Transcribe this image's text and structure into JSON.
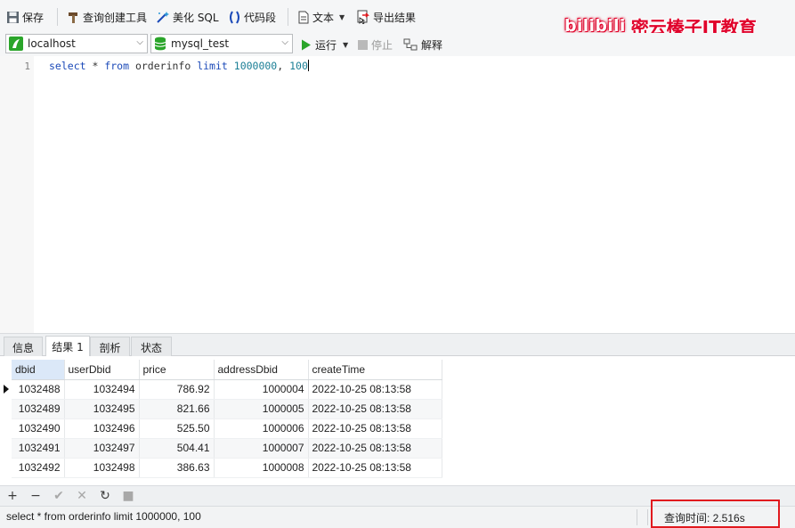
{
  "toolbar": {
    "save": "保存",
    "query_builder": "查询创建工具",
    "beautify": "美化 SQL",
    "snippet": "代码段",
    "text": "文本",
    "export": "导出结果"
  },
  "watermark": {
    "part1": "bilibili",
    "part2": "密云榛子IT教育"
  },
  "connection": {
    "value": "localhost"
  },
  "database": {
    "value": "mysql_test"
  },
  "run": {
    "run_label": "运行",
    "stop_label": "停止",
    "explain_label": "解释"
  },
  "editor": {
    "line_number": "1",
    "tokens": {
      "t1": "select",
      "t2": " * ",
      "t3": "from",
      "t4": " orderinfo ",
      "t5": "limit",
      "t6": " ",
      "t7": "1000000",
      "t8": ", ",
      "t9": "100"
    }
  },
  "tabs": [
    {
      "label": "信息"
    },
    {
      "label": "结果 1"
    },
    {
      "label": "剖析"
    },
    {
      "label": "状态"
    }
  ],
  "grid": {
    "columns": [
      "dbid",
      "userDbid",
      "price",
      "addressDbid",
      "createTime"
    ],
    "rows": [
      [
        "1032488",
        "1032494",
        "786.92",
        "1000004",
        "2022-10-25 08:13:58"
      ],
      [
        "1032489",
        "1032495",
        "821.66",
        "1000005",
        "2022-10-25 08:13:58"
      ],
      [
        "1032490",
        "1032496",
        "525.50",
        "1000006",
        "2022-10-25 08:13:58"
      ],
      [
        "1032491",
        "1032497",
        "504.41",
        "1000007",
        "2022-10-25 08:13:58"
      ],
      [
        "1032492",
        "1032498",
        "386.63",
        "1000008",
        "2022-10-25 08:13:58"
      ]
    ]
  },
  "bottom_buttons": {
    "add": "+",
    "remove": "−",
    "apply": "✔",
    "discard": "✕",
    "refresh": "↻",
    "stop": "■"
  },
  "status": {
    "sql": "select * from orderinfo limit 1000000, 100",
    "query_time": "查询时间: 2.516s"
  },
  "colors": {
    "accent_red": "#e1191e",
    "keyword_blue": "#1c4ab8",
    "number_teal": "#1a7e95",
    "run_green": "#2aa52a"
  }
}
